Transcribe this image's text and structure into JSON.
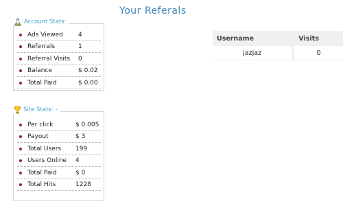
{
  "account": {
    "legend": "Account Stats:",
    "rows": [
      {
        "label": "Ads Viewed",
        "value": "4"
      },
      {
        "label": "Referrals",
        "value": "1"
      },
      {
        "label": "Referral Visits",
        "value": "0"
      },
      {
        "label": "Balance",
        "value": "$ 0.02"
      },
      {
        "label": "Total Paid",
        "value": "$ 0.00"
      }
    ]
  },
  "site": {
    "legend": "Site Stats:",
    "rows": [
      {
        "label": "Per click",
        "value": "$ 0.005"
      },
      {
        "label": "Payout",
        "value": "$ 3"
      },
      {
        "label": "Total Users",
        "value": "199"
      },
      {
        "label": "Users Online",
        "value": "4"
      },
      {
        "label": "Total Paid",
        "value": "$ 0"
      },
      {
        "label": "Total Hits",
        "value": "1228"
      }
    ]
  },
  "referrals": {
    "title": "Your Referals",
    "columns": [
      "Username",
      "Visits"
    ],
    "rows": [
      {
        "username": "jazjaz",
        "visits": "0"
      }
    ]
  },
  "colors": {
    "accent": "#4a9fd0",
    "bullet": "#9b1d3c",
    "header_bg": "#f0f0f0"
  },
  "icons": {
    "account": "flask-icon",
    "site": "trophy-icon"
  }
}
